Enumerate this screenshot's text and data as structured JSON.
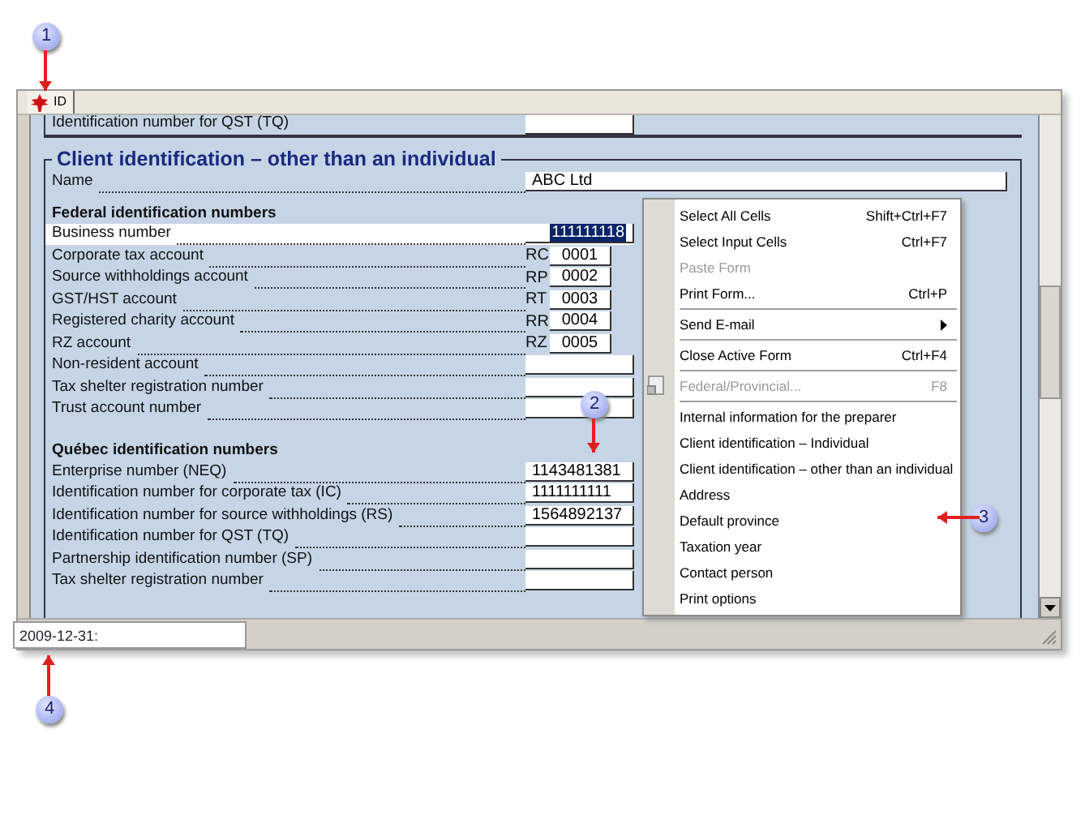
{
  "tab": {
    "label": "ID",
    "selected": true
  },
  "form": {
    "cut_row": {
      "label": "Identification number for QST (TQ)"
    },
    "section_title": "Client identification – other than an individual",
    "rows": [
      {
        "kind": "field",
        "label": "Name",
        "value": "ABC Ltd",
        "selected": false
      },
      {
        "kind": "heading",
        "label": "Federal identification numbers"
      },
      {
        "kind": "field",
        "label": "Business number",
        "value": "111111118",
        "selected": true
      },
      {
        "kind": "prefixed",
        "label": "Corporate tax account",
        "prefix": "RC",
        "value": "0001",
        "selected": false
      },
      {
        "kind": "prefixed",
        "label": "Source withholdings account",
        "prefix": "RP",
        "value": "0002",
        "selected": false
      },
      {
        "kind": "prefixed",
        "label": "GST/HST account",
        "prefix": "RT",
        "value": "0003",
        "selected": false
      },
      {
        "kind": "prefixed",
        "label": "Registered charity account",
        "prefix": "RR",
        "value": "0004",
        "selected": false
      },
      {
        "kind": "prefixed",
        "label": "RZ account",
        "prefix": "RZ",
        "value": "0005",
        "selected": false
      },
      {
        "kind": "field",
        "label": "Non-resident account",
        "selected": false
      },
      {
        "kind": "field",
        "label": "Tax shelter registration number",
        "selected": false
      },
      {
        "kind": "field",
        "label": "Trust account number",
        "selected": false
      },
      {
        "kind": "heading",
        "label": "Québec identification numbers"
      },
      {
        "kind": "field",
        "label": "Enterprise number (NEQ)",
        "value": "1143481381",
        "selected": false
      },
      {
        "kind": "field",
        "label": "Identification number for corporate tax (IC)",
        "value": "1111111111",
        "selected": false
      },
      {
        "kind": "field",
        "label": "Identification number for source withholdings (RS)",
        "value": "1564892137",
        "selected": false
      },
      {
        "kind": "field",
        "label": "Identification number for QST (TQ)",
        "selected": false
      },
      {
        "kind": "field",
        "label": "Partnership identification number (SP)",
        "selected": false
      },
      {
        "kind": "field",
        "label": "Tax shelter registration number",
        "selected": false
      }
    ]
  },
  "context_menu": [
    {
      "kind": "item",
      "label": "Select All Cells",
      "shortcut": "Shift+Ctrl+F7",
      "disabled": false
    },
    {
      "kind": "item",
      "label": "Select Input Cells",
      "shortcut": "Ctrl+F7",
      "disabled": false
    },
    {
      "kind": "item",
      "label": "Paste Form",
      "disabled": true
    },
    {
      "kind": "item",
      "label": "Print Form...",
      "shortcut": "Ctrl+P",
      "disabled": false
    },
    {
      "kind": "separator"
    },
    {
      "kind": "submenu",
      "label": "Send E-mail",
      "disabled": false
    },
    {
      "kind": "separator"
    },
    {
      "kind": "item",
      "label": "Close Active Form",
      "shortcut": "Ctrl+F4",
      "disabled": false
    },
    {
      "kind": "separator"
    },
    {
      "kind": "item",
      "label": "Federal/Provincial...",
      "shortcut": "F8",
      "disabled": true,
      "icon": true
    },
    {
      "kind": "separator"
    },
    {
      "kind": "item",
      "label": "Internal information for the preparer",
      "disabled": false
    },
    {
      "kind": "item",
      "label": "Client identification – Individual",
      "disabled": false
    },
    {
      "kind": "item",
      "label": "Client identification – other than an individual",
      "disabled": false
    },
    {
      "kind": "item",
      "label": "Address",
      "disabled": false
    },
    {
      "kind": "item",
      "label": "Default province",
      "disabled": false
    },
    {
      "kind": "item",
      "label": "Taxation year",
      "disabled": false
    },
    {
      "kind": "item",
      "label": "Contact person",
      "disabled": false
    },
    {
      "kind": "item",
      "label": "Print options",
      "disabled": false
    }
  ],
  "status_bar": {
    "value": "2009-12-31:"
  },
  "callouts": [
    {
      "number": "1"
    },
    {
      "number": "2"
    },
    {
      "number": "3"
    },
    {
      "number": "4"
    }
  ]
}
